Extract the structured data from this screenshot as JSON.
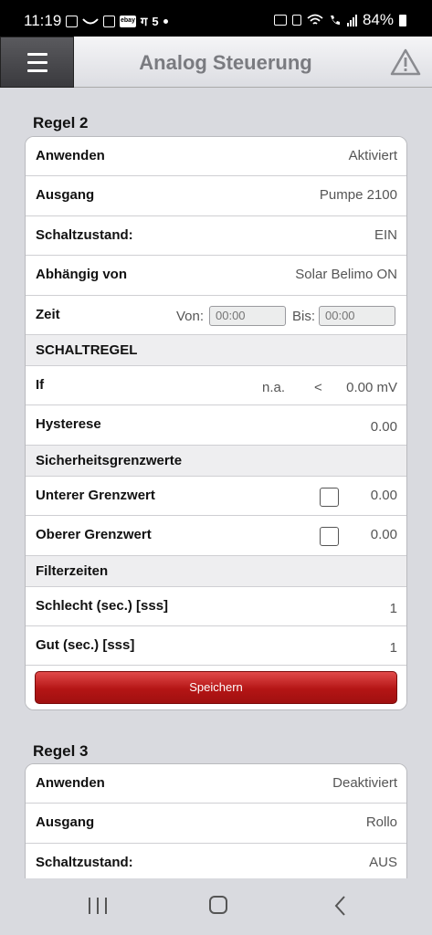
{
  "status_bar": {
    "time": "11:19",
    "battery": "84%",
    "icons_left": [
      "gallery-icon",
      "wave-icon",
      "mail-icon",
      "ebay-icon",
      "app-icon",
      "s-icon",
      "dot-icon"
    ],
    "ebay_label": "ebay",
    "glyph_1": "ग",
    "glyph_2": "5",
    "icons_right": [
      "key-icon",
      "lock-icon",
      "wifi-icon",
      "call-icon",
      "signal-icon",
      "battery-icon"
    ]
  },
  "header": {
    "title": "Analog Steuerung",
    "menu_icon": "hamburger-icon",
    "warn_icon": "warning-icon"
  },
  "regel2": {
    "title": "Regel 2",
    "anwenden_label": "Anwenden",
    "anwenden_value": "Aktiviert",
    "ausgang_label": "Ausgang",
    "ausgang_value": "Pumpe 2100",
    "schaltzustand_label": "Schaltzustand:",
    "schaltzustand_value": "EIN",
    "abhaengig_label": "Abhängig von",
    "abhaengig_value": "Solar Belimo ON",
    "zeit_label": "Zeit",
    "von_label": "Von:",
    "von_placeholder": "00:00",
    "bis_label": "Bis:",
    "bis_placeholder": "00:00",
    "schaltregel_header": "SCHALTREGEL",
    "if_label": "If",
    "if_source": "n.a.",
    "if_operator": "<",
    "if_value": "0.00 mV",
    "hysterese_label": "Hysterese",
    "hysterese_value": "0.00",
    "sicherheit_header": "Sicherheitsgrenzwerte",
    "unterer_label": "Unterer Grenzwert",
    "unterer_value": "0.00",
    "oberer_label": "Oberer Grenzwert",
    "oberer_value": "0.00",
    "filter_header": "Filterzeiten",
    "schlecht_label": "Schlecht (sec.) [sss]",
    "schlecht_value": "1",
    "gut_label": "Gut (sec.) [sss]",
    "gut_value": "1",
    "save_label": "Speichern"
  },
  "regel3": {
    "title": "Regel 3",
    "anwenden_label": "Anwenden",
    "anwenden_value": "Deaktiviert",
    "ausgang_label": "Ausgang",
    "ausgang_value": "Rollo",
    "schaltzustand_label": "Schaltzustand:",
    "schaltzustand_value": "AUS"
  },
  "nav_bar": {
    "recent_icon": "recent-apps-icon",
    "home_icon": "home-icon",
    "back_icon": "back-icon"
  }
}
